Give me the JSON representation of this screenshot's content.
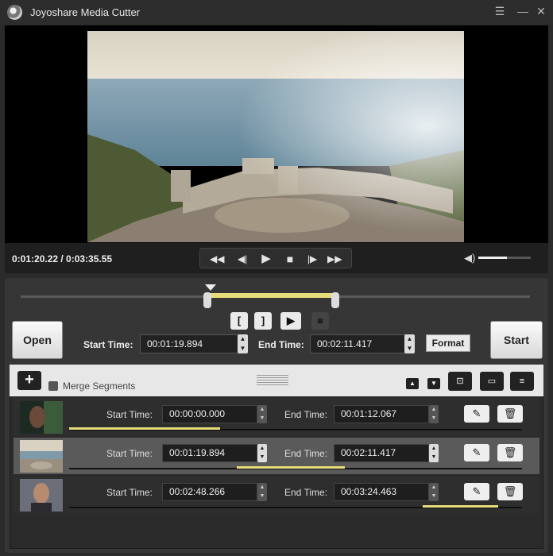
{
  "window": {
    "title": "Joyoshare Media Cutter"
  },
  "player": {
    "timecode": "0:01:20.22 / 0:03:35.55",
    "volume": 0.55
  },
  "editor": {
    "open_label": "Open",
    "start_label": "Start",
    "start_time_label": "Start Time:",
    "start_time_value": "00:01:19.894",
    "end_time_label": "End Time:",
    "end_time_value": "00:02:11.417",
    "format_label": "Format"
  },
  "segments_header": {
    "merge_label": "Merge Segments"
  },
  "segments": [
    {
      "start_label": "Start Time:",
      "start": "00:00:00.000",
      "end_label": "End Time:",
      "end": "00:01:12.067"
    },
    {
      "start_label": "Start Time:",
      "start": "00:01:19.894",
      "end_label": "End Time:",
      "end": "00:02:11.417"
    },
    {
      "start_label": "Start Time:",
      "start": "00:02:48.266",
      "end_label": "End Time:",
      "end": "00:03:24.463"
    }
  ],
  "icons": [
    "menu-icon",
    "minimize-icon",
    "close-icon",
    "prev-segment-icon",
    "prev-frame-icon",
    "play-icon",
    "stop-icon",
    "next-frame-icon",
    "next-segment-icon",
    "volume-icon",
    "mark-in-icon",
    "mark-out-icon",
    "play-segment-icon",
    "stop-segment-icon",
    "add-icon",
    "move-up-icon",
    "move-down-icon",
    "split-icon",
    "export-folder-icon",
    "segment-list-icon",
    "edit-icon",
    "delete-icon"
  ],
  "colors": {
    "accent": "#e6dc7a",
    "panel": "#363636",
    "background": "#2b2b2b"
  }
}
